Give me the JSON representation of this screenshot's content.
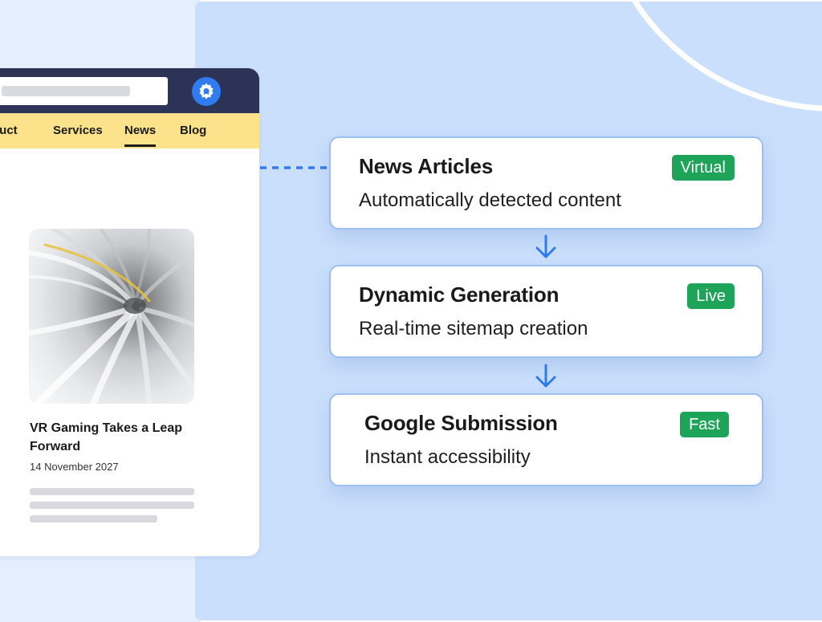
{
  "header": {
    "search_placeholder": "",
    "settings_icon": "gear-icon"
  },
  "nav": {
    "items": [
      {
        "label": "duct",
        "active": false
      },
      {
        "label": "Services",
        "active": false
      },
      {
        "label": "News",
        "active": true
      },
      {
        "label": "Blog",
        "active": false
      }
    ]
  },
  "article": {
    "image_icon": "tunnel-image",
    "title": "VR Gaming Takes a Leap Forward",
    "date": "14 November 2027"
  },
  "steps": [
    {
      "title": "News Articles",
      "subtitle": "Automatically detected content",
      "badge": "Virtual"
    },
    {
      "title": "Dynamic Generation",
      "subtitle": "Real-time sitemap creation",
      "badge": "Live"
    },
    {
      "title": "Google Submission",
      "subtitle": "Instant accessibility",
      "badge": "Fast"
    }
  ],
  "colors": {
    "header_bg": "#2c3356",
    "nav_bg": "#fde28c",
    "accent_blue": "#2f7bf0",
    "badge_green": "#1ea459",
    "panel_bg": "#cadffb",
    "card_border": "#9cc0f5"
  }
}
